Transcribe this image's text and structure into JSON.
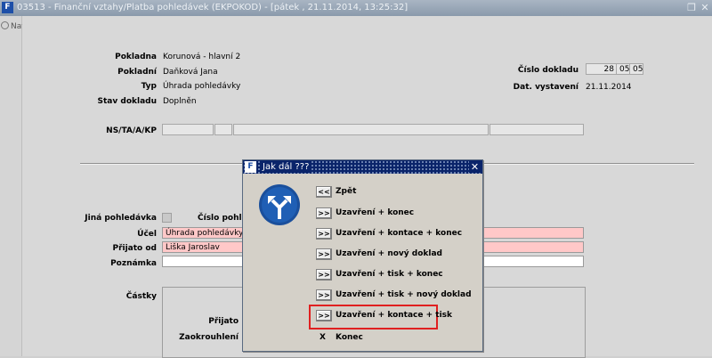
{
  "window": {
    "title": "03513 - Finanční vztahy/Platba pohledávek (EKPOKOD) - [pátek , 21.11.2014, 13:25:32]",
    "app_icon": "F",
    "restore_icon": "restore-icon",
    "close_icon": "close-icon"
  },
  "sidebar": {
    "nav_label": "Nav"
  },
  "header": {
    "pokladna_label": "Pokladna",
    "pokladna_value": "Korunová - hlavní 2",
    "pokladni_label": "Pokladní",
    "pokladni_value": "Daňková Jana",
    "typ_label": "Typ",
    "typ_value": "Úhrada pohledávky",
    "stav_label": "Stav dokladu",
    "stav_value": "Doplněn",
    "cislo_label": "Číslo dokladu",
    "cislo_parts": [
      "28",
      "05",
      "05"
    ],
    "dat_label": "Dat. vystavení",
    "dat_value": "21.11.2014",
    "ns_label": "NS/TA/A/KP"
  },
  "form": {
    "jina_label": "Jiná pohledávka",
    "cislo_poh_label": "Číslo pohled",
    "ucel_label": "Účel",
    "ucel_value": "Úhrada pohledávky",
    "prijato_od_label": "Přijato od",
    "prijato_od_value": "Liška Jaroslav",
    "poznamka_label": "Poznámka",
    "poznamka_value": "",
    "castky_label": "Částky",
    "prijato_label": "Přijato",
    "zaokrouhleni_label": "Zaokrouhlení"
  },
  "dialog": {
    "title": "Jak dál ???",
    "icon": "F",
    "close": "✕",
    "options": [
      {
        "btn": "<<",
        "label": "Zpět"
      },
      {
        "btn": ">>",
        "label": "Uzavření + konec"
      },
      {
        "btn": ">>",
        "label": "Uzavření + kontace + konec"
      },
      {
        "btn": ">>",
        "label": "Uzavření + nový doklad"
      },
      {
        "btn": ">>",
        "label": "Uzavření + tisk + konec"
      },
      {
        "btn": ">>",
        "label": "Uzavření + tisk + nový doklad"
      },
      {
        "btn": ">>",
        "label": "Uzavření + kontace + tisk"
      },
      {
        "btn": "X",
        "label": "Konec"
      }
    ],
    "highlight_color": "#e02020"
  }
}
